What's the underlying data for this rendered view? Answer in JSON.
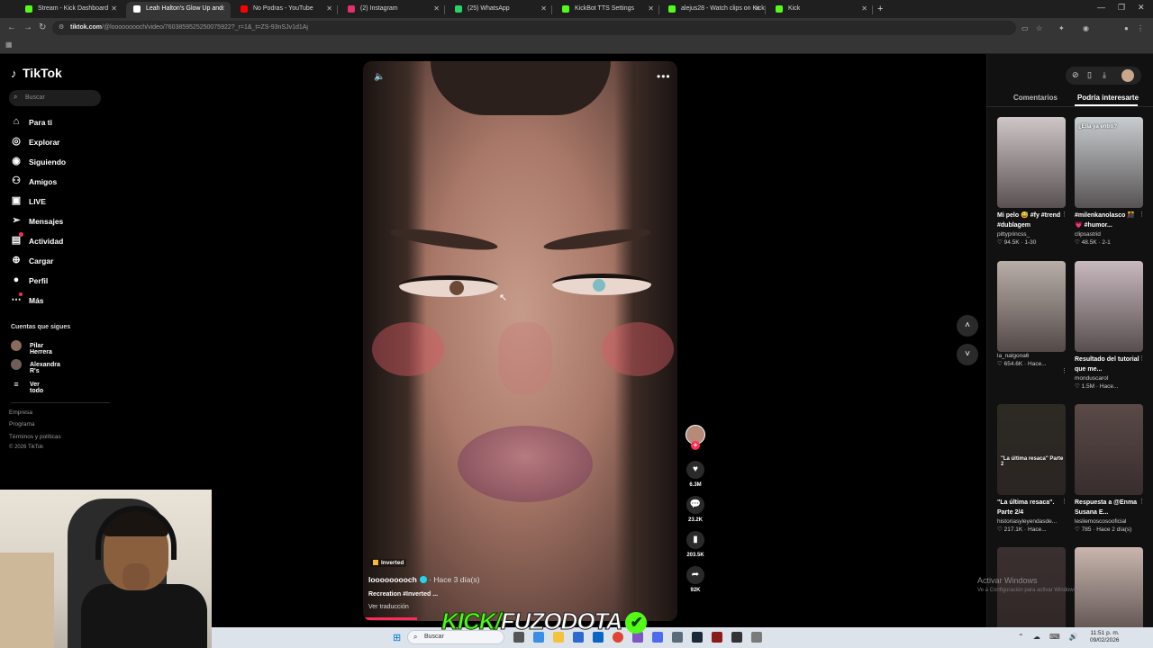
{
  "browser": {
    "tabs": [
      {
        "title": "Stream - Kick Dashboard",
        "color": "#53fc18"
      },
      {
        "title": "Leah Halton's Glow Up and",
        "color": "#ffffff"
      },
      {
        "title": "No Podras - YouTube",
        "color": "#ff0000"
      },
      {
        "title": "(2) Instagram",
        "color": "#e1306c"
      },
      {
        "title": "(25) WhatsApp",
        "color": "#25d366"
      },
      {
        "title": "KickBot TTS Settings",
        "color": "#53fc18"
      },
      {
        "title": "alejus28 - Watch clips on Kick",
        "color": "#53fc18"
      },
      {
        "title": "Kick",
        "color": "#53fc18"
      }
    ],
    "url_host": "tiktok.com",
    "url_path": "/@looooooooch/video/7603859525250075922?_r=1&_t=ZS-93nSJv1d1Aj"
  },
  "sidebar": {
    "logo": "TikTok",
    "search_placeholder": "Buscar",
    "nav": [
      {
        "label": "Para ti",
        "icon": "home-icon"
      },
      {
        "label": "Explorar",
        "icon": "compass-icon"
      },
      {
        "label": "Siguiendo",
        "icon": "following-icon"
      },
      {
        "label": "Amigos",
        "icon": "friends-icon"
      },
      {
        "label": "LIVE",
        "icon": "live-icon"
      },
      {
        "label": "Mensajes",
        "icon": "messages-icon"
      },
      {
        "label": "Actividad",
        "icon": "activity-icon"
      },
      {
        "label": "Cargar",
        "icon": "upload-icon"
      },
      {
        "label": "Perfil",
        "icon": "profile-icon"
      },
      {
        "label": "Más",
        "icon": "more-icon"
      }
    ],
    "following_heading": "Cuentas que sigues",
    "following": [
      "Pilar Herrera",
      "Alexandra R's"
    ],
    "see_all": "Ver todo",
    "footer": [
      "Empresa",
      "Programa",
      "Términos y políticas",
      "© 2026 TikTok"
    ]
  },
  "video": {
    "badge": "Inverted",
    "author": "looooooooch",
    "time": "· Hace 3 día(s)",
    "caption": "Recreation #Inverted ...",
    "translate": "Ver traducción",
    "likes": "6.3M",
    "comments": "23.2K",
    "saves": "203.5K",
    "shares": "92K"
  },
  "right_panel": {
    "tab_comments": "Comentarios",
    "tab_interest": "Podría interesarte",
    "cards": [
      {
        "title": "Mi pelo 😅 #fy #trend #dublagem",
        "user": "pittyprincss_",
        "meta": "♡ 94.5K · 1-30",
        "thumb_text": "",
        "bg": "#cfc6c8"
      },
      {
        "title": "#milenkanolasco 🎊 💗 #humor...",
        "user": "clipsastrid",
        "meta": "♡ 48.5K · 2-1",
        "thumb_text": "¿Ella ya entró?",
        "bg": "#c8cdd0"
      },
      {
        "title": "",
        "user": "la_nalgona6",
        "meta": "♡ 654.6K · Hace...",
        "thumb_text": "",
        "bg": "#b9aea8"
      },
      {
        "title": "Resultado del tutorial que me...",
        "user": "monduscarol",
        "meta": "♡ 1.5M · Hace...",
        "thumb_text": "",
        "bg": "#c8b9be"
      },
      {
        "title": "\"La última resaca\". Parte 2/4",
        "user": "historiasyleyendasde...",
        "meta": "♡ 217.1K · Hace...",
        "thumb_text": "\"La última resaca\" Parte 2",
        "bg": "#2d2a24"
      },
      {
        "title": "Respuesta a @Enma Susana E...",
        "user": "lesliemoscosooficial",
        "meta": "♡ 785 · Hace 2 día(s)",
        "thumb_text": "",
        "bg": "#5a4a48"
      },
      {
        "title": "",
        "user": "",
        "meta": "",
        "thumb_text": "",
        "bg": "#3b3030"
      },
      {
        "title": "",
        "user": "",
        "meta": "",
        "thumb_text": "",
        "bg": "#c9b6ae"
      }
    ]
  },
  "overlay": {
    "kick": "KICK/",
    "channel": "FUZODOTA",
    "activate_title": "Activar Windows",
    "activate_sub": "Ve a Configuración para activar Windows."
  },
  "taskbar": {
    "search_placeholder": "Buscar",
    "time": "11:51 p. m.",
    "date": "09/02/2026"
  }
}
